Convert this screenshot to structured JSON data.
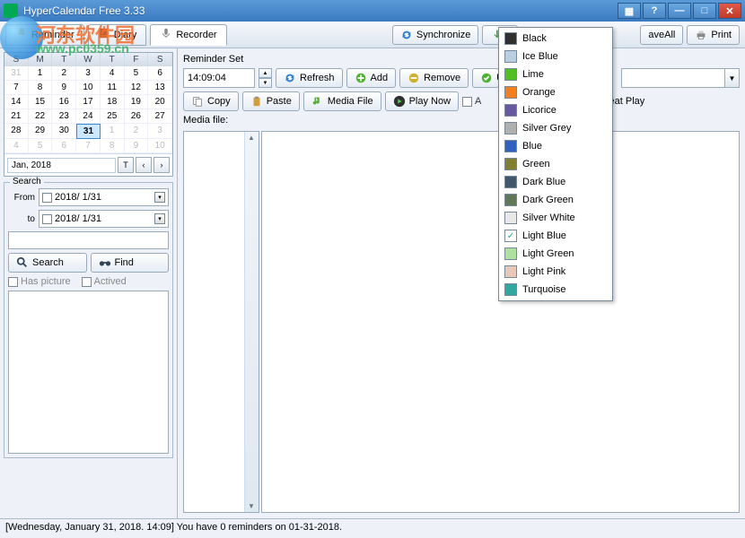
{
  "title": "HyperCalendar Free 3.33",
  "tabs": {
    "reminder": "Reminder",
    "diary": "Diary",
    "recorder": "Recorder"
  },
  "toolbar": {
    "synchronize": "Synchronize",
    "import_partial": "Imp",
    "saveall_partial": "aveAll",
    "print": "Print"
  },
  "calendar": {
    "dow": [
      "S",
      "M",
      "T",
      "W",
      "T",
      "F",
      "S"
    ],
    "cells": [
      {
        "n": "31",
        "g": true
      },
      {
        "n": "1"
      },
      {
        "n": "2"
      },
      {
        "n": "3"
      },
      {
        "n": "4"
      },
      {
        "n": "5"
      },
      {
        "n": "6"
      },
      {
        "n": "7"
      },
      {
        "n": "8"
      },
      {
        "n": "9"
      },
      {
        "n": "10"
      },
      {
        "n": "11"
      },
      {
        "n": "12"
      },
      {
        "n": "13"
      },
      {
        "n": "14"
      },
      {
        "n": "15"
      },
      {
        "n": "16"
      },
      {
        "n": "17"
      },
      {
        "n": "18"
      },
      {
        "n": "19"
      },
      {
        "n": "20"
      },
      {
        "n": "21"
      },
      {
        "n": "22"
      },
      {
        "n": "23"
      },
      {
        "n": "24"
      },
      {
        "n": "25"
      },
      {
        "n": "26"
      },
      {
        "n": "27"
      },
      {
        "n": "28"
      },
      {
        "n": "29"
      },
      {
        "n": "30"
      },
      {
        "n": "31",
        "t": true
      },
      {
        "n": "1",
        "g": true
      },
      {
        "n": "2",
        "g": true
      },
      {
        "n": "3",
        "g": true
      },
      {
        "n": "4",
        "g": true
      },
      {
        "n": "5",
        "g": true
      },
      {
        "n": "6",
        "g": true
      },
      {
        "n": "7",
        "g": true
      },
      {
        "n": "8",
        "g": true
      },
      {
        "n": "9",
        "g": true
      },
      {
        "n": "10",
        "g": true
      }
    ],
    "month": "Jan, 2018",
    "today_btn": "T"
  },
  "search": {
    "label": "Search",
    "from": "From",
    "to": "to",
    "date_from": "2018/ 1/31",
    "date_to": "2018/ 1/31",
    "search_btn": "Search",
    "find_btn": "Find",
    "has_picture": "Has picture",
    "actived": "Actived"
  },
  "reminder": {
    "set_label": "Reminder Set",
    "time": "14:09:04",
    "refresh": "Refresh",
    "add": "Add",
    "remove": "Remove",
    "u_partial": "U",
    "copy": "Copy",
    "paste": "Paste",
    "media_file_btn": "Media File",
    "play_now": "Play Now",
    "a_partial": "A",
    "repeat_play_partial": "peat Play",
    "media_file_label": "Media file:"
  },
  "colors": [
    {
      "name": "Black",
      "hex": "#303030"
    },
    {
      "name": "Ice Blue",
      "hex": "#b8d0e0"
    },
    {
      "name": "Lime",
      "hex": "#50c020"
    },
    {
      "name": "Orange",
      "hex": "#f08020"
    },
    {
      "name": "Licorice",
      "hex": "#6858a0"
    },
    {
      "name": "Silver Grey",
      "hex": "#b0b0b0"
    },
    {
      "name": "Blue",
      "hex": "#3060c0"
    },
    {
      "name": "Green",
      "hex": "#808030"
    },
    {
      "name": "Dark Blue",
      "hex": "#405868"
    },
    {
      "name": "Dark Green",
      "hex": "#607858"
    },
    {
      "name": "Silver White",
      "hex": "#e8e8e8"
    },
    {
      "name": "Light Blue",
      "hex": "#c8e0f0",
      "selected": true
    },
    {
      "name": "Light Green",
      "hex": "#b0e0a0"
    },
    {
      "name": "Light Pink",
      "hex": "#e8c8b8"
    },
    {
      "name": "Turquoise",
      "hex": "#30a8a0"
    }
  ],
  "status": "[Wednesday, January 31, 2018. 14:09] You have 0 reminders on 01-31-2018.",
  "watermark": {
    "line1": "河东软件园",
    "line2": "www.pc0359.cn"
  }
}
